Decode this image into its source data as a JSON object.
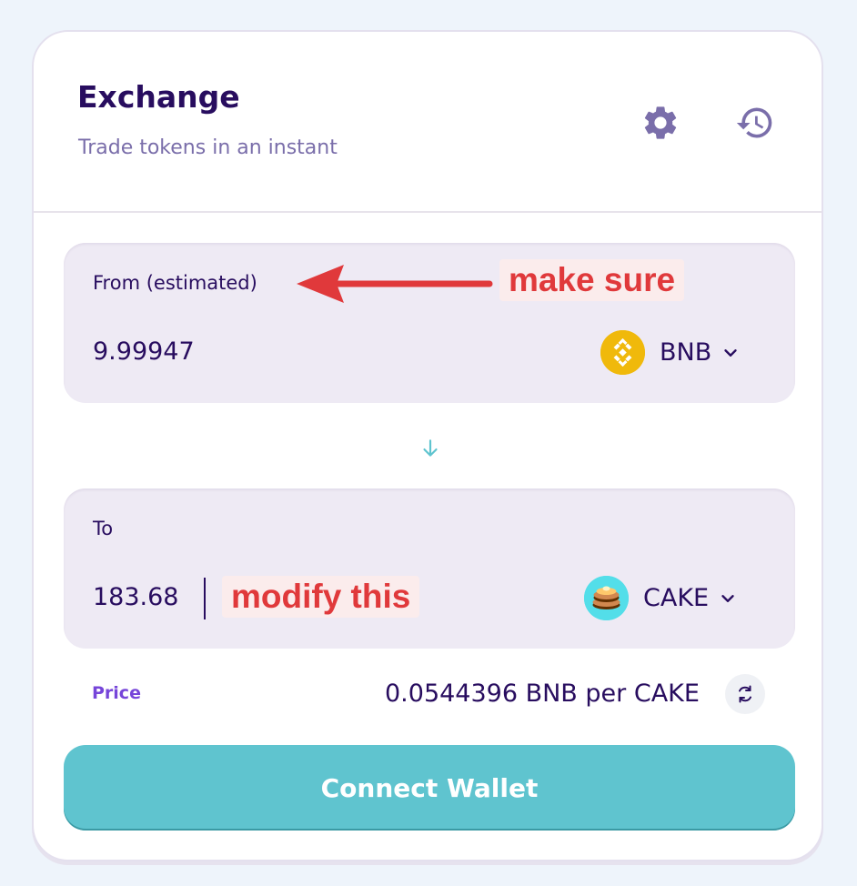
{
  "header": {
    "title": "Exchange",
    "subtitle": "Trade tokens in an instant",
    "icons": [
      "gear-icon",
      "history-icon"
    ]
  },
  "from": {
    "label": "From (estimated)",
    "amount": "9.99947",
    "token": "BNB"
  },
  "to": {
    "label": "To",
    "amount": "183.68",
    "token": "CAKE"
  },
  "price": {
    "label": "Price",
    "value": "0.0544396 BNB per CAKE"
  },
  "connect_button": "Connect Wallet",
  "annotations": {
    "make_sure": "make sure",
    "modify_this": "modify this"
  },
  "colors": {
    "primary_text": "#280d5f",
    "secondary_text": "#7a6eaa",
    "accent": "#5fc4cf",
    "price_label": "#7645d9",
    "annotation": "#e0393b"
  }
}
